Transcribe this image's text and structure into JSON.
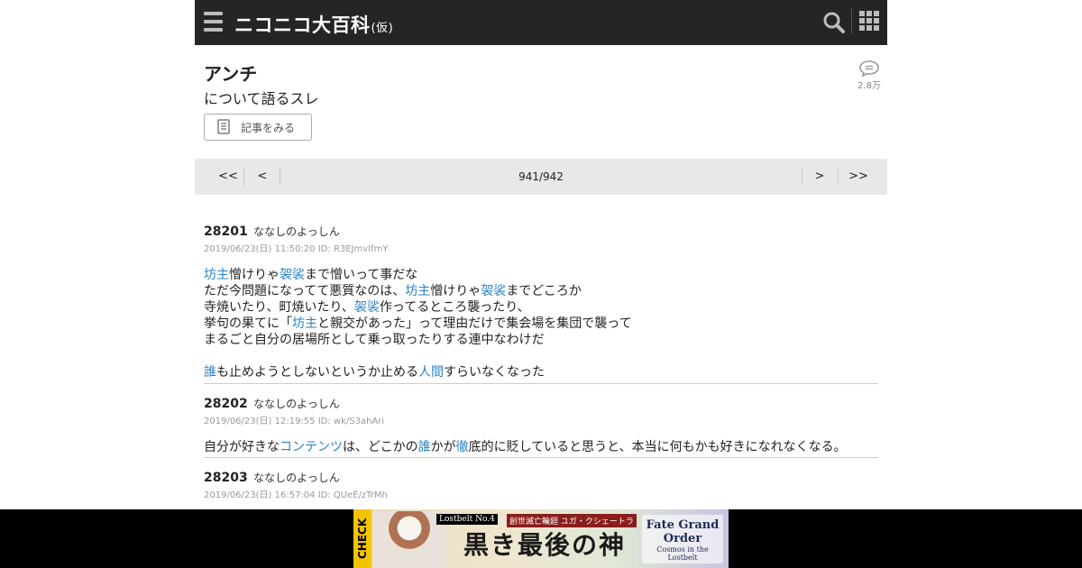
{
  "header": {
    "logo_text": "ニコニコ大百科",
    "logo_suffix": "(仮)",
    "menu_icon": "hamburger-icon",
    "search_icon": "search-icon",
    "apps_icon": "grid-icon"
  },
  "article": {
    "title": "アンチ",
    "subtitle": "について語るスレ",
    "comment_count": "2.8万",
    "view_article_label": "記事をみる"
  },
  "pager": {
    "first": "<<",
    "prev": "<",
    "page": "941/942",
    "next": ">",
    "last": ">>"
  },
  "posts": [
    {
      "number": "28201",
      "name": "ななしのよっしん",
      "meta": "2019/06/23(日) 11:50:20 ID: R3EJmvIfmY",
      "lines": [
        [
          {
            "t": "坊主",
            "link": true
          },
          {
            "t": "憎けりゃ"
          },
          {
            "t": "袈裟",
            "link": true
          },
          {
            "t": "まで憎いって事だな"
          }
        ],
        [
          {
            "t": "ただ今問題になってて悪質なのは、"
          },
          {
            "t": "坊主",
            "link": true
          },
          {
            "t": "憎けりゃ"
          },
          {
            "t": "袈裟",
            "link": true
          },
          {
            "t": "までどころか"
          }
        ],
        [
          {
            "t": "寺焼いたり、町焼いたり、"
          },
          {
            "t": "袈裟",
            "link": true
          },
          {
            "t": "作ってるところ襲ったり、"
          }
        ],
        [
          {
            "t": "挙句の果てに「"
          },
          {
            "t": "坊主",
            "link": true
          },
          {
            "t": "と親交があった」って理由だけで集会場を集団で襲って"
          }
        ],
        [
          {
            "t": "まるごと自分の居場所として乗っ取ったりする連中なわけだ"
          }
        ],
        [],
        [
          {
            "t": "誰",
            "link": true
          },
          {
            "t": "も止めようとしないというか止める"
          },
          {
            "t": "人間",
            "link": true
          },
          {
            "t": "すらいなくなった"
          }
        ]
      ]
    },
    {
      "number": "28202",
      "name": "ななしのよっしん",
      "meta": "2019/06/23(日) 12:19:55 ID: wk/S3ahAri",
      "lines": [
        [
          {
            "t": "自分が好きな"
          },
          {
            "t": "コンテンツ",
            "link": true
          },
          {
            "t": "は、どこかの"
          },
          {
            "t": "誰",
            "link": true
          },
          {
            "t": "かが"
          },
          {
            "t": "徹",
            "link": true
          },
          {
            "t": "底的に貶していると思うと、本当に何もかも好きになれなくなる。"
          }
        ]
      ]
    },
    {
      "number": "28203",
      "name": "ななしのよっしん",
      "meta": "2019/06/23(日) 16:57:04 ID: QUeE/zTrMh",
      "lines": []
    }
  ],
  "ad": {
    "check": "CHECK",
    "tag1": "Lostbelt No.4",
    "tag2": "創世滅亡輪廻 ユガ・クシェートラ",
    "headline": "黒き最後の神",
    "brand1": "Fate Grand Order",
    "brand2": "Cosmos in the Lostbelt"
  }
}
